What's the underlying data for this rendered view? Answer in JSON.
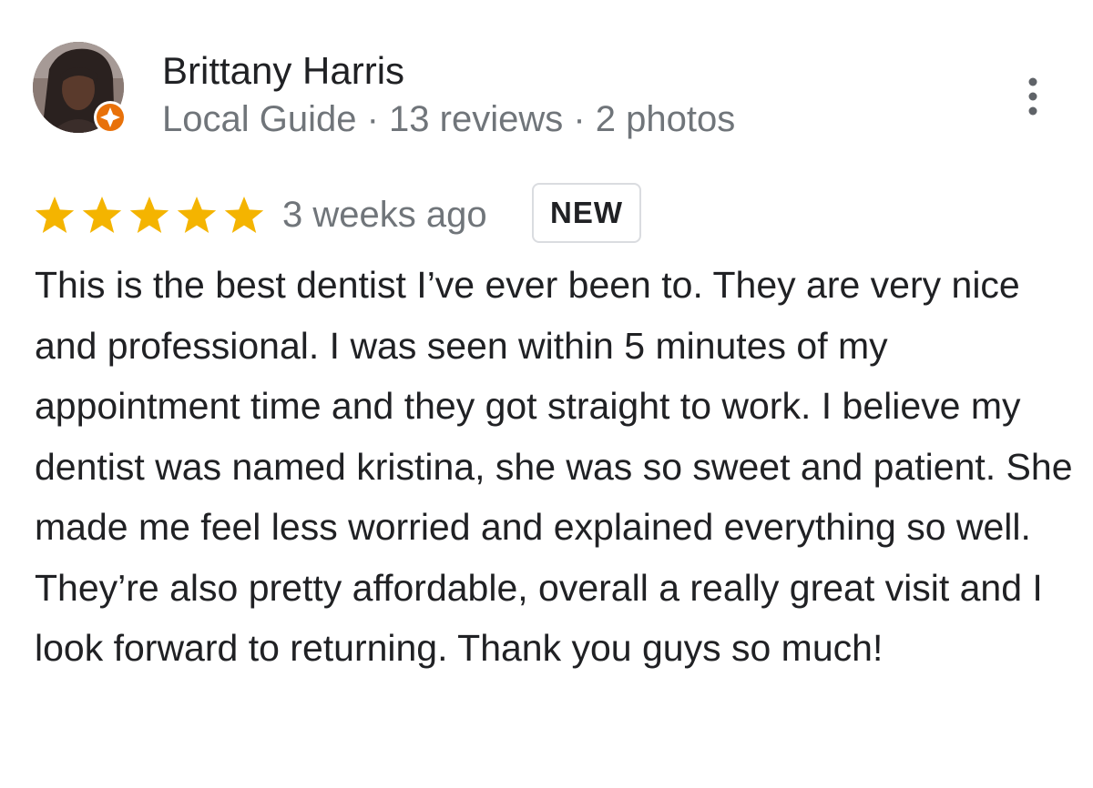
{
  "review": {
    "author": {
      "name": "Brittany Harris",
      "meta": "Local Guide · 13 reviews · 2 photos",
      "avatar_icon": "profile-photo",
      "badge_icon": "local-guide-star-icon"
    },
    "rating": {
      "stars": 5,
      "max_stars": 5,
      "star_color": "#f4b400"
    },
    "date": "3 weeks ago",
    "badge": "NEW",
    "menu_icon": "more-vert-icon",
    "text": "This is the best dentist I’ve ever been to. They are very nice and professional. I was seen within 5 minutes of my appointment time and they got straight to work. I believe my dentist was named kristina, she was so sweet and patient. She made me feel less worried and explained everything so well. They’re also pretty affordable, overall a really great visit and I look forward to returning. Thank you guys so much!"
  },
  "colors": {
    "primary_text": "#202124",
    "secondary_text": "#70757a",
    "badge_border": "#dadce0",
    "local_guide_orange": "#e8710a"
  }
}
